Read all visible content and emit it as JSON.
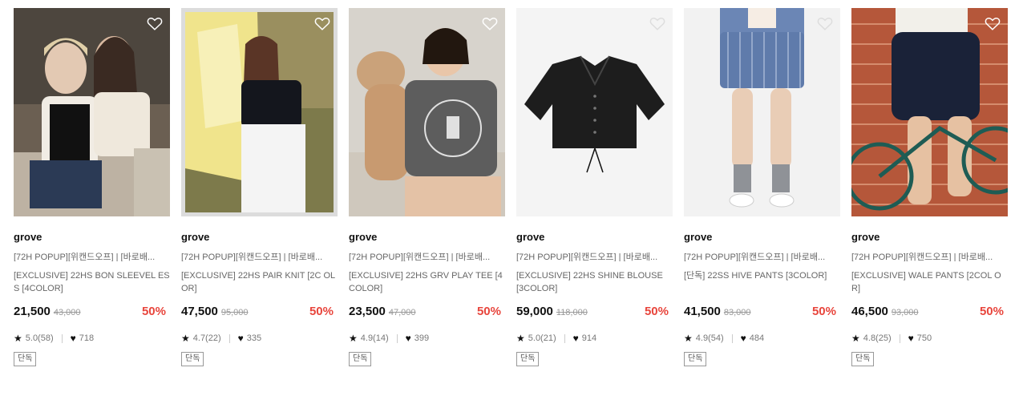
{
  "products": [
    {
      "brand": "grove",
      "title1": "[72H POPUP][위캔드오프] | [바로배...",
      "title2": "[EXCLUSIVE] 22HS BON SLEEVEL ESS [4COLOR]",
      "sale_price": "21,500",
      "original_price": "43,000",
      "discount": "50%",
      "rating": "5.0(58)",
      "likes": "718",
      "tag": "단독",
      "image": "two women sitting, vintage photo",
      "liked": false
    },
    {
      "brand": "grove",
      "title1": "[72H POPUP][위캔드오프] | [바로배...",
      "title2": "[EXCLUSIVE] 22HS PAIR KNIT [2C OLOR]",
      "sale_price": "47,500",
      "original_price": "95,000",
      "discount": "50%",
      "rating": "4.7(22)",
      "likes": "335",
      "tag": "단독",
      "image": "woman in knit with laundry",
      "liked": false
    },
    {
      "brand": "grove",
      "title1": "[72H POPUP][위캔드오프] | [바로배...",
      "title2": "[EXCLUSIVE] 22HS GRV PLAY TEE [4COLOR]",
      "sale_price": "23,500",
      "original_price": "47,000",
      "discount": "50%",
      "rating": "4.9(14)",
      "likes": "399",
      "tag": "단독",
      "image": "girl with plush dog in graphic tee",
      "liked": false
    },
    {
      "brand": "grove",
      "title1": "[72H POPUP][위캔드오프] | [바로배...",
      "title2": "[EXCLUSIVE] 22HS SHINE BLOUSE [3COLOR]",
      "sale_price": "59,000",
      "original_price": "118,000",
      "discount": "50%",
      "rating": "5.0(21)",
      "likes": "914",
      "tag": "단독",
      "image": "black blouse on white",
      "liked": false
    },
    {
      "brand": "grove",
      "title1": "[72H POPUP][위캔드오프] | [바로배...",
      "title2": "[단독] 22SS HIVE PANTS [3COLOR]",
      "sale_price": "41,500",
      "original_price": "83,000",
      "discount": "50%",
      "rating": "4.9(54)",
      "likes": "484",
      "tag": "단독",
      "image": "striped blue shorts with loafers",
      "liked": false
    },
    {
      "brand": "grove",
      "title1": "[72H POPUP][위캔드오프] | [바로배...",
      "title2": "[EXCLUSIVE] WALE PANTS [2COL OR]",
      "sale_price": "46,500",
      "original_price": "93,000",
      "discount": "50%",
      "rating": "4.8(25)",
      "likes": "750",
      "tag": "단독",
      "image": "navy shorts with bicycle and brick wall",
      "liked": false
    }
  ],
  "colors": {
    "discount": "#e8453c",
    "text_dark": "#111111",
    "text_muted": "#666666"
  },
  "icons": {
    "wishlist": "heart-outline-icon",
    "rating": "star-icon",
    "likes": "heart-filled-icon"
  }
}
